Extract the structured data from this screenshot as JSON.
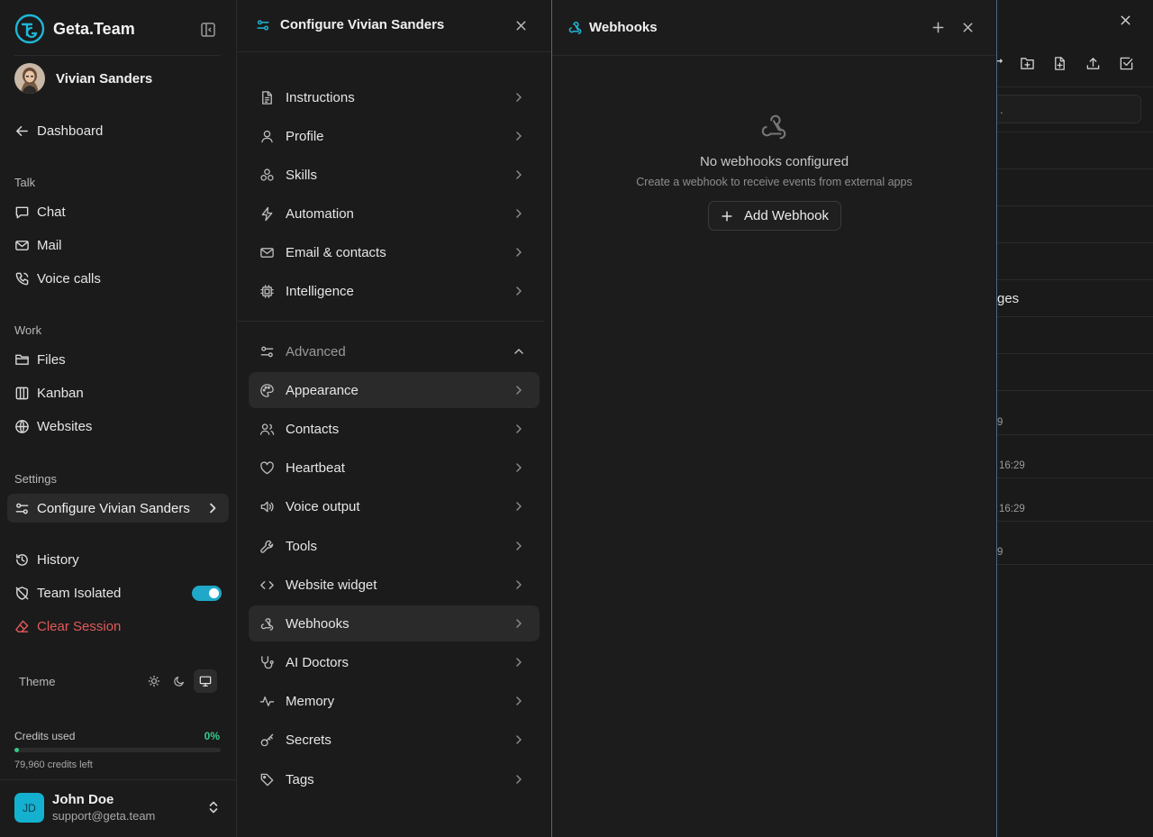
{
  "brand": {
    "name": "Geta.Team"
  },
  "agent": {
    "name": "Vivian Sanders"
  },
  "nav": {
    "dashboard": "Dashboard",
    "talk_label": "Talk",
    "chat": "Chat",
    "mail": "Mail",
    "voice_calls": "Voice calls",
    "work_label": "Work",
    "files": "Files",
    "kanban": "Kanban",
    "websites": "Websites",
    "settings_label": "Settings",
    "configure": "Configure Vivian Sanders",
    "history": "History",
    "team_isolated": "Team Isolated",
    "team_isolated_on": true,
    "clear_session": "Clear Session"
  },
  "theme": {
    "label": "Theme",
    "options": [
      "light",
      "dark",
      "system"
    ],
    "selected": "system"
  },
  "credits": {
    "label": "Credits used",
    "percent_text": "0%",
    "percent": 0.02,
    "left": "79,960 credits left"
  },
  "user": {
    "initials": "JD",
    "name": "John Doe",
    "email": "support@geta.team"
  },
  "config_panel": {
    "title": "Configure Vivian Sanders",
    "items": [
      {
        "label": "Instructions",
        "icon": "document-icon"
      },
      {
        "label": "Profile",
        "icon": "user-icon"
      },
      {
        "label": "Skills",
        "icon": "skills-icon"
      },
      {
        "label": "Automation",
        "icon": "bolt-icon"
      },
      {
        "label": "Email & contacts",
        "icon": "mail-icon"
      },
      {
        "label": "Intelligence",
        "icon": "cpu-icon"
      }
    ],
    "advanced_label": "Advanced",
    "advanced_items": [
      {
        "label": "Appearance",
        "icon": "palette-icon"
      },
      {
        "label": "Contacts",
        "icon": "users-icon"
      },
      {
        "label": "Heartbeat",
        "icon": "heart-icon"
      },
      {
        "label": "Voice output",
        "icon": "speaker-icon"
      },
      {
        "label": "Tools",
        "icon": "wrench-icon"
      },
      {
        "label": "Website widget",
        "icon": "code-icon"
      },
      {
        "label": "Webhooks",
        "icon": "webhook-icon"
      },
      {
        "label": "AI Doctors",
        "icon": "stethoscope-icon"
      },
      {
        "label": "Memory",
        "icon": "activity-icon"
      },
      {
        "label": "Secrets",
        "icon": "key-icon"
      },
      {
        "label": "Tags",
        "icon": "tag-icon"
      }
    ]
  },
  "webhooks": {
    "title": "Webhooks",
    "empty_title": "No webhooks configured",
    "empty_subtitle": "Create a webhook to receive events from external apps",
    "add_button": "Add Webhook"
  },
  "background": {
    "search_placeholder_fragment": ".",
    "row_text": "ges",
    "times": [
      "9",
      "16:29",
      "16:29",
      "9"
    ]
  },
  "colors": {
    "accent": "#1fb6d6",
    "danger": "#e15a5a",
    "success": "#36c98a"
  }
}
